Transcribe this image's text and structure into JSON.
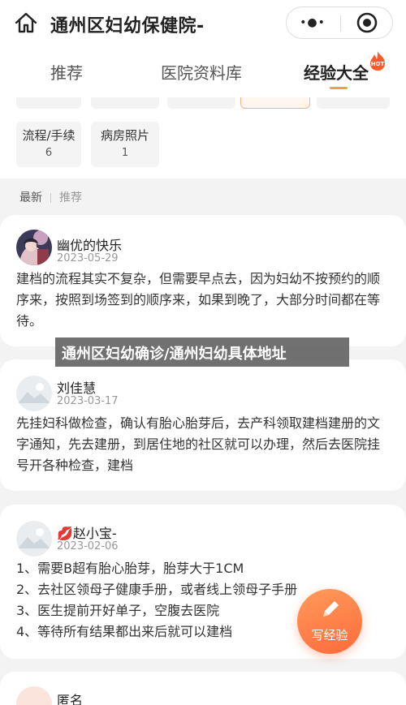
{
  "header": {
    "title": "通州区妇幼保健院-",
    "more_glyph": "•●•"
  },
  "tabs": [
    {
      "label": "推荐"
    },
    {
      "label": "医院资料库"
    },
    {
      "label": "经验大全",
      "badge": "HOT"
    }
  ],
  "categories": [
    {
      "name": "流程/手续",
      "count": "6"
    },
    {
      "name": "病房照片",
      "count": "1"
    }
  ],
  "filter": {
    "active": "最新",
    "inactive": "推荐"
  },
  "posts": [
    {
      "user": "幽优的快乐",
      "date": "2023-05-29",
      "text": "建档的流程其实不复杂，但需要早点去，因为妇幼不按预约的顺序来，按照到场签到的顺序来，如果到晚了，大部分时间都在等待。"
    },
    {
      "user": "刘佳慧",
      "date": "2023-03-17",
      "text": "先挂妇科做检查，确认有胎心胎芽后，去产科领取建档建册的文字通知，先去建册，到居住地的社区就可以办理，然后去医院挂号开各种检查，建档"
    },
    {
      "user": "赵小宝-",
      "user_emoji": "💋",
      "date": "2023-02-06",
      "lines": [
        "1、需要B超有胎心胎芽，胎芽大于1CM",
        "2、去社区领母子健康手册，或者线上领母子手册",
        "3、医生提前开好单子，空腹去医院",
        "4、等待所有结果都出来后就可以建档"
      ]
    },
    {
      "user": "匿名"
    }
  ],
  "overlay_banner": "通州区妇幼确诊/通州妇幼具体地址",
  "fab_label": "写经验",
  "colors": {
    "accent": "#f0a040",
    "fab": "#ff7a45",
    "hot": "#ff5a2a"
  }
}
